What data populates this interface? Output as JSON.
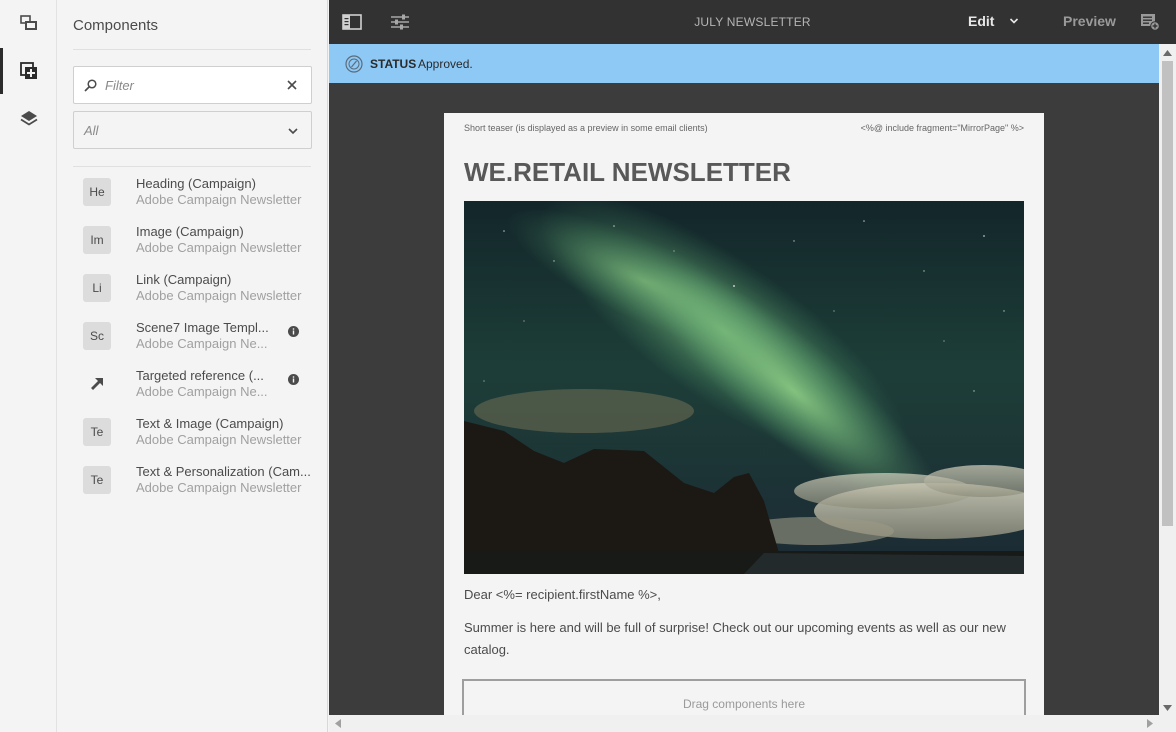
{
  "panel": {
    "title": "Components",
    "filter_placeholder": "Filter",
    "group_select": "All",
    "items": [
      {
        "abbr": "He",
        "name": "Heading (Campaign)",
        "group": "Adobe Campaign Newsletter",
        "info": false
      },
      {
        "abbr": "Im",
        "name": "Image (Campaign)",
        "group": "Adobe Campaign Newsletter",
        "info": false
      },
      {
        "abbr": "Li",
        "name": "Link (Campaign)",
        "group": "Adobe Campaign Newsletter",
        "info": false
      },
      {
        "abbr": "Sc",
        "name": "Scene7 Image Templ...",
        "group": "Adobe Campaign Ne...",
        "info": true
      },
      {
        "abbr": "",
        "name": "Targeted reference (...",
        "group": "Adobe Campaign Ne...",
        "info": true,
        "icon": "arrow-up-right-icon"
      },
      {
        "abbr": "Te",
        "name": "Text & Image (Campaign)",
        "group": "Adobe Campaign Newsletter",
        "info": false
      },
      {
        "abbr": "Te",
        "name": "Text & Personalization (Cam...",
        "group": "Adobe Campaign Newsletter",
        "info": false
      }
    ]
  },
  "toolbar": {
    "page_title": "JULY NEWSLETTER",
    "mode": "Edit",
    "preview": "Preview"
  },
  "status": {
    "label": "STATUS",
    "value": "Approved."
  },
  "page": {
    "teaser": "Short teaser (is displayed as a preview in some email clients)",
    "fragment": "<%@ include fragment=\"MirrorPage\" %>",
    "title": "WE.RETAIL NEWSLETTER",
    "greeting": "Dear <%= recipient.firstName %>,",
    "body": "Summer is here and will be full of surprise! Check out our upcoming events as well as our new catalog.",
    "dropzone": "Drag components here"
  },
  "colors": {
    "toolbar_bg": "#323232",
    "status_bg": "#8ec9f6",
    "canvas_bg": "#3c3c3c"
  }
}
